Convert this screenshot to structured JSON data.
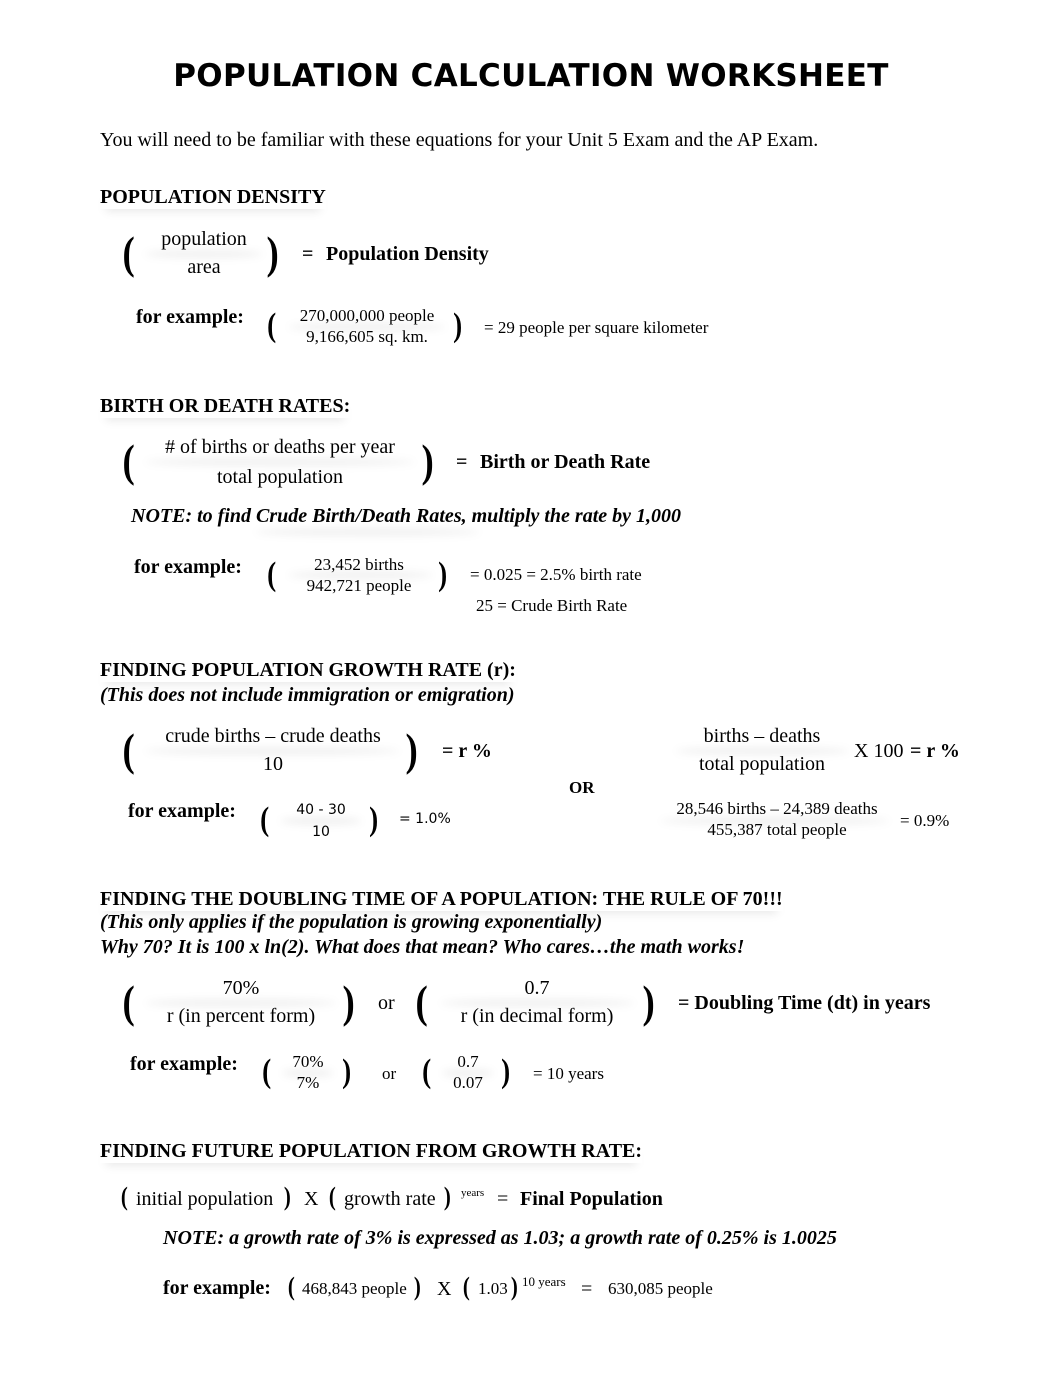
{
  "title": "POPULATION CALCULATION WORKSHEET",
  "intro": "You will need to be familiar with these equations for your Unit 5 Exam and the AP Exam.",
  "density": {
    "heading": "POPULATION DENSITY",
    "numerator": "population",
    "denominator": "area",
    "equals": "=",
    "result": "Population Density",
    "example_label": "for example:",
    "example_numerator": "270,000,000 people",
    "example_denominator": "9,166,605 sq. km.",
    "example_result": "=  29 people per square kilometer"
  },
  "rates": {
    "heading": "BIRTH OR DEATH RATES:",
    "numerator": "# of births or deaths per year",
    "denominator": "total population",
    "equals": "=",
    "result": "Birth or Death Rate",
    "note": "NOTE: to find Crude Birth/Death Rates, multiply the rate by 1,000",
    "example_label": "for example:",
    "example_numerator": "23,452 births",
    "example_denominator": "942,721 people",
    "example_result_1": "= 0.025  =  2.5% birth rate",
    "example_result_2": "25  =  Crude Birth Rate"
  },
  "growth": {
    "heading": "FINDING POPULATION GROWTH RATE (r):",
    "subheading": "(This does not include immigration or emigration)",
    "left_numerator": "crude births – crude deaths",
    "left_denominator": "10",
    "left_result": "= r %",
    "or_label": "OR",
    "right_numerator": "births – deaths",
    "right_denominator": "total population",
    "right_multiplier": "X 100",
    "right_result": "= r %",
    "example_label": "for example:",
    "left_example_numerator": "40 - 30",
    "left_example_denominator": "10",
    "left_example_result": "=  1.0%",
    "right_example_numerator": "28,546 births – 24,389 deaths",
    "right_example_denominator": "455,387 total people",
    "right_example_result": "= 0.9%"
  },
  "doubling": {
    "heading": "FINDING THE DOUBLING TIME OF A POPULATION: THE RULE OF 70!!!",
    "subheading_1": "(This only applies if the population is growing exponentially)",
    "subheading_2": "Why 70?  It is 100 x ln(2).  What does that mean?  Who cares…the math works!",
    "a_numerator": "70%",
    "a_denominator": "r (in percent form)",
    "or_label": "or",
    "b_numerator": "0.7",
    "b_denominator": "r (in decimal form)",
    "result": "= Doubling Time (dt) in years",
    "example_label": "for example:",
    "ex_a_numerator": "70%",
    "ex_a_denominator": "7%",
    "ex_or": "or",
    "ex_b_numerator": "0.7",
    "ex_b_denominator": "0.07",
    "ex_result": "= 10 years"
  },
  "future": {
    "heading": "FINDING FUTURE POPULATION FROM GROWTH RATE:",
    "initial": "initial population",
    "times": "X",
    "rate": "growth rate",
    "exponent": "years",
    "equals": "=",
    "result": "Final Population",
    "note": "NOTE: a growth rate of 3% is expressed as 1.03; a growth rate of 0.25% is 1.0025",
    "example_label": "for example:",
    "ex_initial": "468,843 people",
    "ex_times": "X",
    "ex_rate": "1.03",
    "ex_exponent": "10 years",
    "ex_equals": "=",
    "ex_result": "630,085 people"
  }
}
